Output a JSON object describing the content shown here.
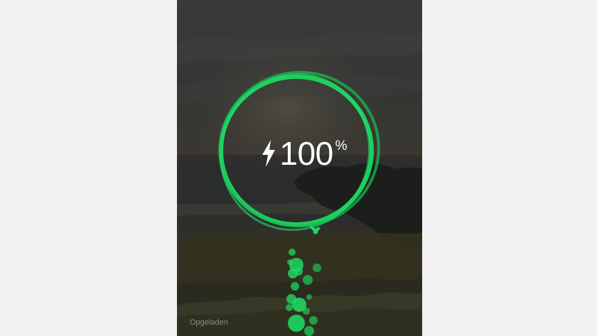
{
  "lockscreen": {
    "charging": {
      "level_value": "100",
      "level_unit": "%",
      "level_fraction": 1.0,
      "icon": "lightning-bolt-icon",
      "accent_color": "#1ed760"
    },
    "status_text": "Opgeladen"
  }
}
